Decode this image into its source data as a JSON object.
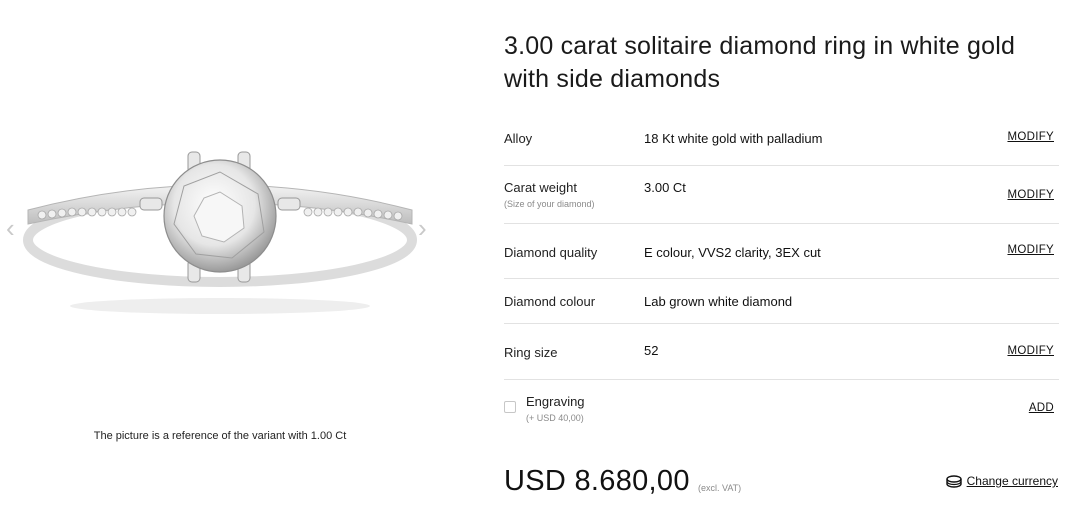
{
  "product": {
    "title_line1": "3.00 carat solitaire diamond ring in white gold",
    "title_line2": "with side diamonds"
  },
  "gallery": {
    "caption": "The picture is a reference of the variant with 1.00 Ct",
    "prev_icon": "chevron-left-icon",
    "next_icon": "chevron-right-icon"
  },
  "specs": [
    {
      "label": "Alloy",
      "sub": "",
      "value": "18 Kt white gold with palladium",
      "action": "MODIFY"
    },
    {
      "label": "Carat weight",
      "sub": "(Size of your diamond)",
      "value": "3.00 Ct",
      "action": "MODIFY"
    },
    {
      "label": "Diamond quality",
      "sub": "",
      "value": "E colour, VVS2 clarity, 3EX cut",
      "action": "MODIFY"
    },
    {
      "label": "Diamond colour",
      "sub": "",
      "value": "Lab grown white diamond",
      "action": ""
    },
    {
      "label": "Ring size",
      "sub": "",
      "value": "52",
      "action": "MODIFY"
    }
  ],
  "engraving": {
    "label": "Engraving",
    "sub": "(+ USD 40,00)",
    "action": "ADD"
  },
  "price": {
    "amount": "USD 8.680,00",
    "vat_note": "(excl. VAT)"
  },
  "currency": {
    "label": "Change currency",
    "icon": "coins-icon"
  }
}
